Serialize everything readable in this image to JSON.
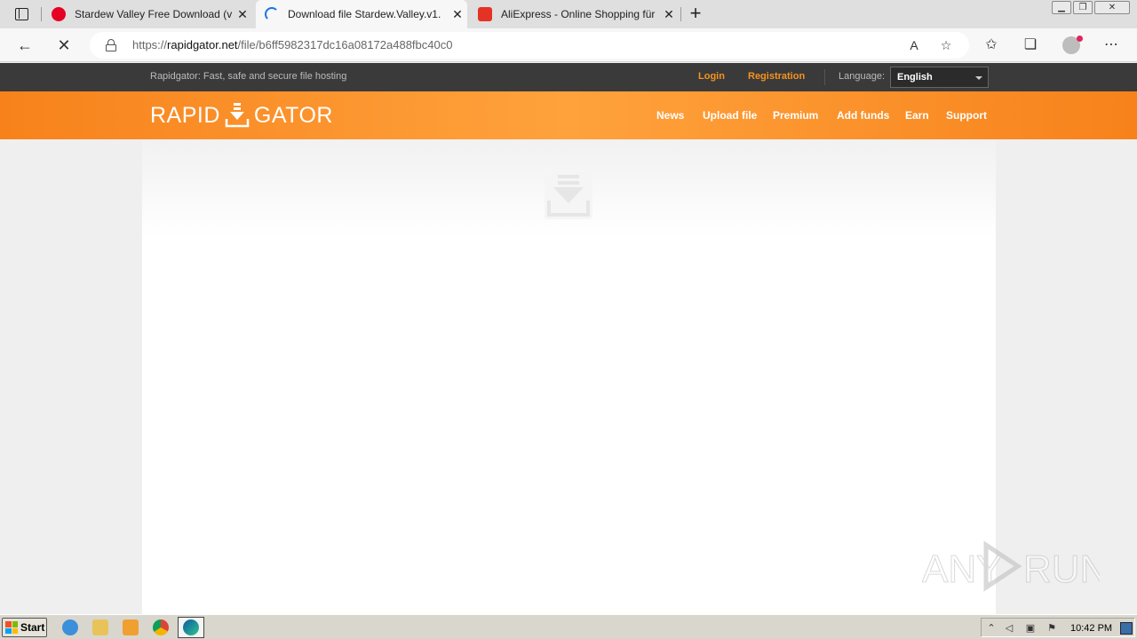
{
  "browser": {
    "tabs": [
      {
        "title": "Stardew Valley Free Download (v",
        "icon": "pinterest-icon",
        "color": "#e60023"
      },
      {
        "title": "Download file Stardew.Valley.v1.",
        "icon": "loading-icon",
        "color": "#1a73e8"
      },
      {
        "title": "AliExpress - Online Shopping für",
        "icon": "aliexpress-icon",
        "color": "#e43225"
      }
    ],
    "new_tab_label": "+",
    "url_scheme": "https://",
    "url_host": "rapidgator.net",
    "url_path": "/file/b6ff5982317dc16a08172a488fbc40c0"
  },
  "site": {
    "tagline": "Rapidgator: Fast, safe and secure file hosting",
    "login_label": "Login",
    "registration_label": "Registration",
    "language_label": "Language:",
    "language_value": "English",
    "logo_left": "RAPID",
    "logo_right": "GATOR",
    "nav": [
      "News",
      "Upload file",
      "Premium",
      "Add funds",
      "Earn",
      "Support"
    ],
    "accent_color": "#f7931e"
  },
  "watermark": {
    "text_left": "ANY",
    "text_right": "RUN"
  },
  "taskbar": {
    "start_label": "Start",
    "clock": "10:42 PM"
  }
}
